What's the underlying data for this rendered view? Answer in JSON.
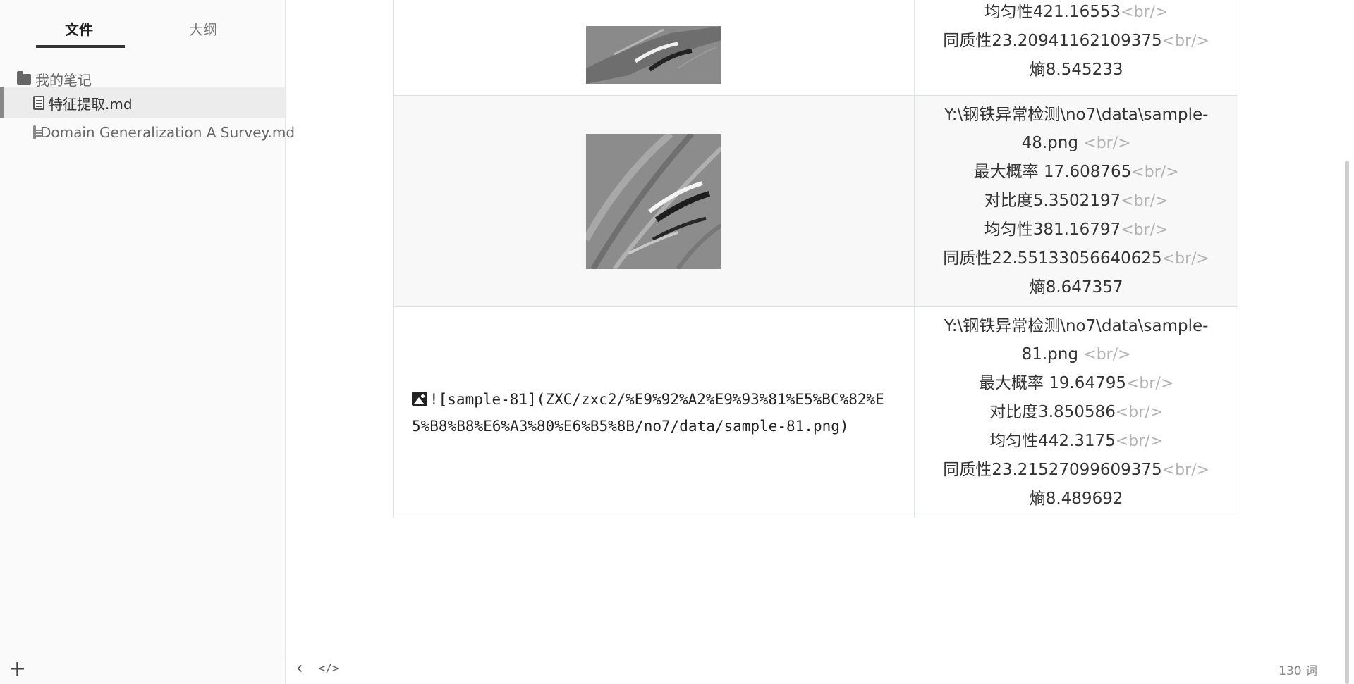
{
  "sidebar": {
    "tabs": [
      {
        "label": "文件",
        "active": true
      },
      {
        "label": "大纲",
        "active": false
      }
    ],
    "tree": {
      "folder": "我的笔记",
      "files": [
        {
          "label": "特征提取.md",
          "active": true
        },
        {
          "label": "Domain Generalization A Survey.md",
          "active": false
        }
      ]
    },
    "add_label": "+"
  },
  "table": {
    "br": "<br/>",
    "rows": [
      {
        "image": "texture",
        "info": {
          "homogeneity_uniformity": "均匀性421.16553",
          "homogeneity": "同质性23.2094116210937​5",
          "entropy": "熵8.545233"
        }
      },
      {
        "image": "texture",
        "info": {
          "path1": "Y:\\钢铁异常检测\\no7\\data\\sample-",
          "path2": "48.png ",
          "max_prob": "最大概率 17.608765",
          "contrast": "对比度5.3502197",
          "uniformity": "均匀性381.16797",
          "homogeneity": "同质性22.55133056640625",
          "entropy": "熵8.647357"
        }
      },
      {
        "image_markdown": "![sample-81](ZXC/zxc2/%E9%92%A2%E9%93%81%E5%BC%82%E5%B8%B8%E6%A3%80%E6%B5%8B/no7/data/sample-81.png)",
        "info": {
          "path1": "Y:\\钢铁异常检测\\no7\\data\\sample-",
          "path2": "81.png ",
          "max_prob": "最大概率 19.64795",
          "contrast": "对比度3.850586",
          "uniformity": "均匀性442.3175",
          "homogeneity": "同质性23.21527099609375",
          "entropy": "熵8.489692"
        }
      }
    ]
  },
  "statusbar": {
    "back_icon": "chevron-left-icon",
    "source_icon": "code-icon",
    "source_label": "</>",
    "back_label": "‹",
    "word_count": "130 词"
  }
}
